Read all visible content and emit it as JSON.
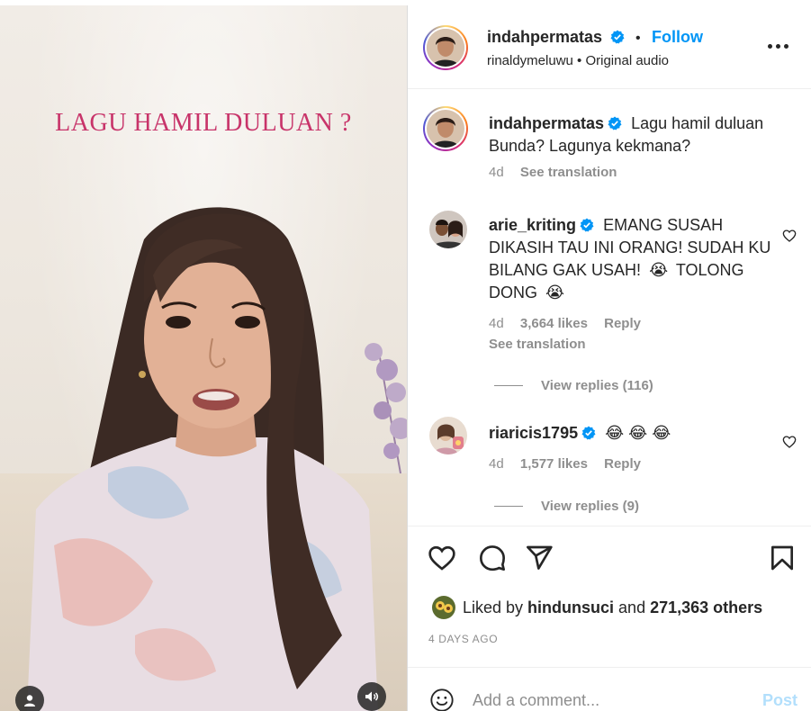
{
  "video": {
    "overlay_text": "LAGU HAMIL DULUAN ?"
  },
  "header": {
    "username": "indahpermatas",
    "follow_label": "Follow",
    "audio_author": "rinaldymeluwu",
    "audio_label": "Original audio"
  },
  "caption": {
    "username": "indahpermatas",
    "text": "Lagu hamil duluan Bunda? Lagunya kekmana?",
    "time": "4d",
    "see_translation": "See translation"
  },
  "comments": [
    {
      "username": "arie_kriting",
      "text": "EMANG SUSAH DIKASIH TAU INI ORANG! SUDAH KU BILANG GAK USAH!",
      "text_tail": "TOLONG DONG",
      "emoji_1": "😭",
      "emoji_2": "😭",
      "time": "4d",
      "likes": "3,664 likes",
      "reply": "Reply",
      "see_translation": "See translation",
      "view_replies": "View replies (116)"
    },
    {
      "username": "riaricis1795",
      "emojis": [
        "😂",
        "😂",
        "😂"
      ],
      "time": "4d",
      "likes": "1,577 likes",
      "reply": "Reply",
      "view_replies": "View replies (9)"
    }
  ],
  "likes": {
    "prefix": "Liked by",
    "user": "hindunsuci",
    "and": "and",
    "count": "271,363 others"
  },
  "posted": "4 DAYS AGO",
  "composer": {
    "placeholder": "Add a comment...",
    "post_label": "Post"
  },
  "colors": {
    "accent_blue": "#0095f6",
    "overlay_pink": "#c8346a",
    "muted_gray": "#8e8e8e",
    "post_disabled": "#b2dffc"
  },
  "icons": [
    "verified-badge-icon",
    "more-options-icon",
    "heart-icon",
    "comment-icon",
    "share-icon",
    "save-icon",
    "emoji-icon",
    "user-icon",
    "sound-icon"
  ]
}
